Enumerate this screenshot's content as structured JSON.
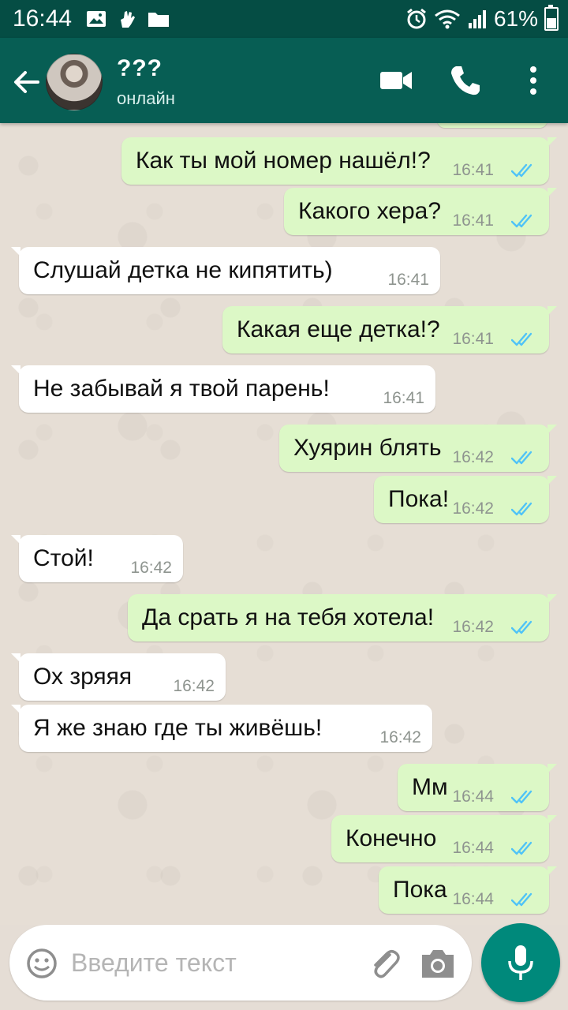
{
  "status_bar": {
    "time": "16:44",
    "battery": "61%",
    "battery_level": 0.61,
    "icons": [
      "gallery-icon",
      "hand-icon",
      "folder-icon",
      "alarm-icon",
      "wifi-icon",
      "signal-icon",
      "battery-icon"
    ]
  },
  "header": {
    "contact_name": "???",
    "contact_status": "онлайн",
    "icons": [
      "back-arrow-icon",
      "video-call-icon",
      "phone-icon",
      "more-vert-icon"
    ]
  },
  "messages": [
    {
      "dir": "out",
      "text": "Как ты мой номер нашёл!?",
      "time": "16:41",
      "read": true
    },
    {
      "dir": "out",
      "text": "Какого хера?",
      "time": "16:41",
      "read": true
    },
    {
      "dir": "in",
      "text": "Слушай детка не кипятить)",
      "time": "16:41"
    },
    {
      "dir": "out",
      "text": "Какая еще детка!?",
      "time": "16:41",
      "read": true
    },
    {
      "dir": "in",
      "text": "Не забывай я твой парень!",
      "time": "16:41"
    },
    {
      "dir": "out",
      "text": "Хуярин блять",
      "time": "16:42",
      "read": true
    },
    {
      "dir": "out",
      "text": "Пока!",
      "time": "16:42",
      "read": true
    },
    {
      "dir": "in",
      "text": "Стой!",
      "time": "16:42"
    },
    {
      "dir": "out",
      "text": "Да срать я на тебя хотела!",
      "time": "16:42",
      "read": true
    },
    {
      "dir": "in",
      "text": "Ох зряяя",
      "time": "16:42"
    },
    {
      "dir": "in",
      "text": "Я же знаю где ты живёшь!",
      "time": "16:42"
    },
    {
      "dir": "out",
      "text": "Мм",
      "time": "16:44",
      "read": true
    },
    {
      "dir": "out",
      "text": "Конечно",
      "time": "16:44",
      "read": true
    },
    {
      "dir": "out",
      "text": "Пока",
      "time": "16:44",
      "read": true
    }
  ],
  "input": {
    "placeholder": "Введите текст",
    "icons": [
      "emoji-icon",
      "attach-icon",
      "camera-icon",
      "mic-icon"
    ]
  },
  "colors": {
    "header": "#075e54",
    "status_bar": "#054d44",
    "outgoing_bubble": "#dcf8c6",
    "incoming_bubble": "#ffffff",
    "read_ticks": "#4fc3f7",
    "mic_button": "#00897b"
  }
}
